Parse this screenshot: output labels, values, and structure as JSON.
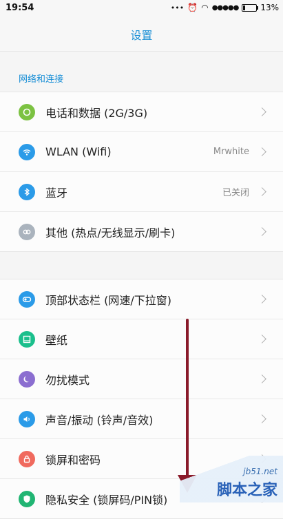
{
  "status": {
    "time": "19:54",
    "battery": "13%",
    "battery_level": 0.13
  },
  "header": {
    "title": "设置"
  },
  "sections": [
    {
      "label": "网络和连接",
      "items": [
        {
          "label": "电话和数据 (2G/3G)",
          "value": "",
          "icon": "phone-data-icon",
          "color": "#7cc242"
        },
        {
          "label": "WLAN (Wifi)",
          "value": "Mrwhite",
          "icon": "wifi-icon",
          "color": "#2b9be8"
        },
        {
          "label": "蓝牙",
          "value": "已关闭",
          "icon": "bluetooth-icon",
          "color": "#2b9be8"
        },
        {
          "label": "其他 (热点/无线显示/刷卡)",
          "value": "",
          "icon": "link-icon",
          "color": "#aab3bd"
        }
      ]
    },
    {
      "label": "",
      "items": [
        {
          "label": "顶部状态栏 (网速/下拉窗)",
          "value": "",
          "icon": "toggle-icon",
          "color": "#2b9be8"
        },
        {
          "label": "壁纸",
          "value": "",
          "icon": "wallpaper-icon",
          "color": "#1bbf8c"
        },
        {
          "label": "勿扰模式",
          "value": "",
          "icon": "moon-icon",
          "color": "#8b6ed0"
        },
        {
          "label": "声音/振动 (铃声/音效)",
          "value": "",
          "icon": "speaker-icon",
          "color": "#2b9be8"
        },
        {
          "label": "锁屏和密码",
          "value": "",
          "icon": "lock-icon",
          "color": "#f06a5e"
        },
        {
          "label": "隐私安全 (锁屏码/PIN锁)",
          "value": "",
          "icon": "shield-icon",
          "color": "#21b573"
        }
      ]
    }
  ],
  "watermark": {
    "site": "jb51.net",
    "name": "脚本之家"
  }
}
